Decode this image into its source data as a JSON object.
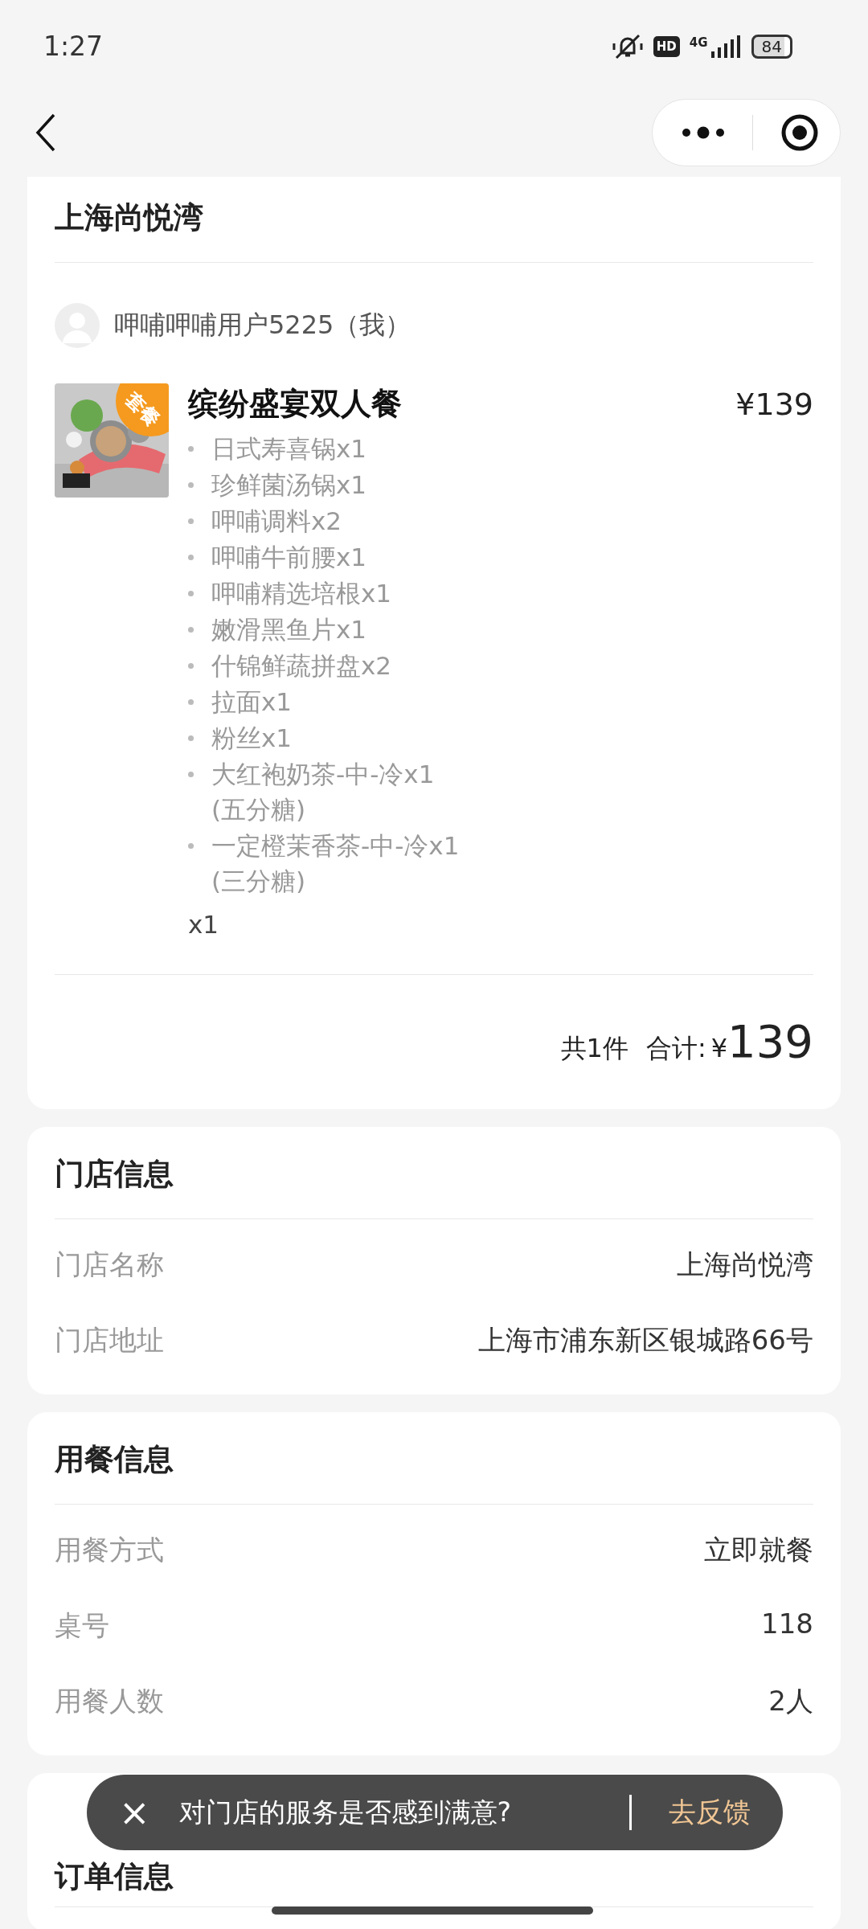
{
  "status_bar": {
    "time": "1:27",
    "network": "4G",
    "hd": "HD",
    "battery": "84"
  },
  "order": {
    "store_title": "上海尚悦湾",
    "user": "呷哺呷哺用户5225（我）",
    "product": {
      "badge": "套餐",
      "name": "缤纷盛宴双人餐",
      "price": "¥139",
      "quantity": "x1",
      "items": [
        {
          "name": "日式寿喜锅x1"
        },
        {
          "name": "珍鲜菌汤锅x1"
        },
        {
          "name": "呷哺调料x2"
        },
        {
          "name": "呷哺牛前腰x1"
        },
        {
          "name": "呷哺精选培根x1"
        },
        {
          "name": "嫩滑黑鱼片x1"
        },
        {
          "name": "什锦鲜蔬拼盘x2"
        },
        {
          "name": "拉面x1"
        },
        {
          "name": "粉丝x1"
        },
        {
          "name": "大红袍奶茶-中-冷x1",
          "note": "(五分糖)"
        },
        {
          "name": "一定橙茉香茶-中-冷x1",
          "note": "(三分糖)"
        }
      ]
    },
    "count": "共1件",
    "total_label": "合计:",
    "total_currency": "¥",
    "total": "139"
  },
  "sections": [
    {
      "title": "门店信息",
      "rows": [
        {
          "label": "门店名称",
          "value": "上海尚悦湾"
        },
        {
          "label": "门店地址",
          "value": "上海市浦东新区银城路66号"
        }
      ]
    },
    {
      "title": "用餐信息",
      "rows": [
        {
          "label": "用餐方式",
          "value": "立即就餐"
        },
        {
          "label": "桌号",
          "value": "118"
        },
        {
          "label": "用餐人数",
          "value": "2人"
        }
      ]
    },
    {
      "title": "订单信息"
    }
  ],
  "toast": {
    "close": "×",
    "message": "对门店的服务是否感到满意?",
    "action": "去反馈"
  }
}
